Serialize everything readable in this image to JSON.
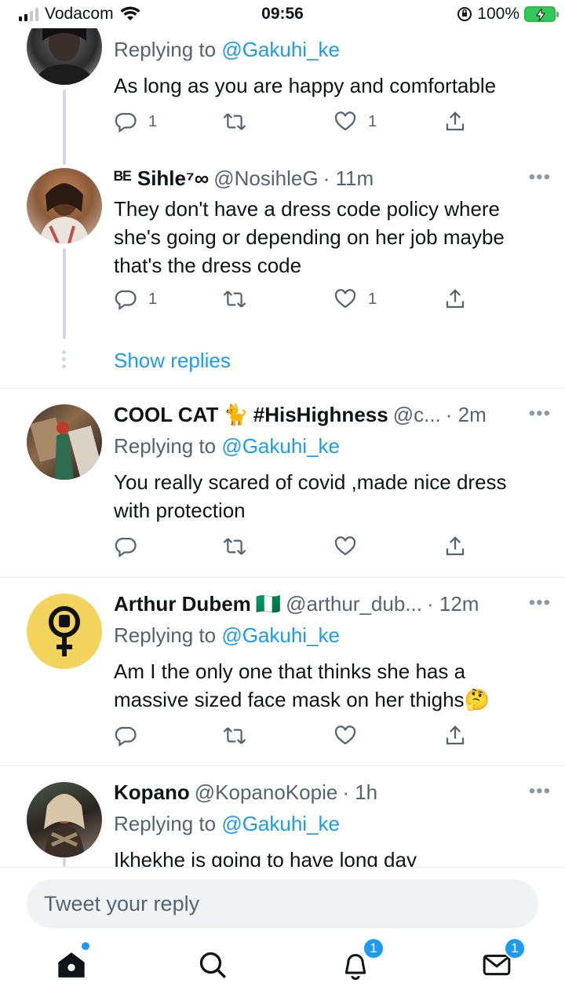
{
  "status_bar": {
    "carrier": "Vodacom",
    "time": "09:56",
    "battery": "100%"
  },
  "tweets": [
    {
      "replying_label": "Replying to",
      "replying_to": "@Gakuhi_ke",
      "text": "As long as you are happy and comfortable",
      "reply_count": "1",
      "like_count": "1"
    },
    {
      "name": "ᴮᴱ Sihle⁷∞",
      "handle": "@NosihleG",
      "time": "· 11m",
      "text": "They don't have a dress code policy where she's going or depending on her job maybe that's the dress code",
      "reply_count": "1",
      "like_count": "1"
    },
    {
      "show_replies": "Show replies"
    },
    {
      "name": "COOL CAT",
      "name_suffix": "#HisHighness",
      "emoji": "🐈",
      "handle": "@c...",
      "time": "· 2m",
      "replying_label": "Replying to",
      "replying_to": "@Gakuhi_ke",
      "text": "You really scared of covid ,made nice dress with protection"
    },
    {
      "name": "Arthur Dubem",
      "emoji": "🇳🇬",
      "handle": "@arthur_dub...",
      "time": "· 12m",
      "replying_label": "Replying to",
      "replying_to": "@Gakuhi_ke",
      "text": "Am I the only one that thinks she has a massive sized face mask on her thighs🤔"
    },
    {
      "name": "Kopano",
      "handle": "@KopanoKopie",
      "time": "· 1h",
      "replying_label": "Replying to",
      "replying_to": "@Gakuhi_ke",
      "text": "Ikhekhe is going to have long day"
    }
  ],
  "composer": {
    "placeholder": "Tweet your reply"
  },
  "nav": {
    "notifications_badge": "1",
    "messages_badge": "1"
  },
  "colors": {
    "accent": "#1d9bf0",
    "text_secondary": "#536471",
    "divider": "#e6ecf0",
    "battery": "#34c759"
  },
  "icons": [
    "signal-icon",
    "wifi-icon",
    "orientation-lock-icon",
    "battery-icon",
    "reply-icon",
    "retweet-icon",
    "like-icon",
    "share-icon",
    "more-icon",
    "home-icon",
    "search-icon",
    "notifications-icon",
    "messages-icon"
  ]
}
